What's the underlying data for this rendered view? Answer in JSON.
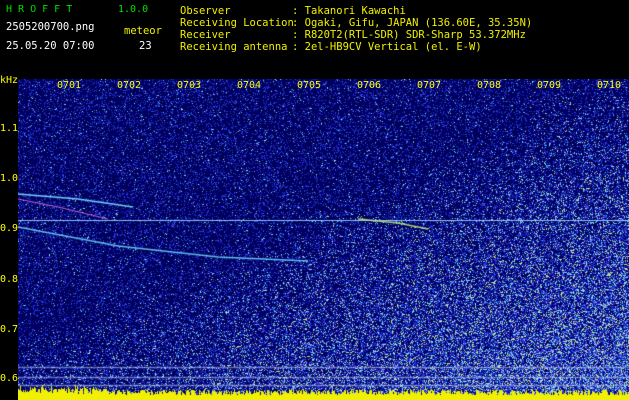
{
  "header": {
    "app_name": "H R O F F T",
    "version": "1.0.0",
    "filename": "2505200700.png",
    "datetime": "25.05.20 07:00",
    "count_label": "meteor",
    "count_value": "23",
    "info_labels": [
      "Observer",
      "Receiving Location",
      "Receiver",
      "Receiving antenna"
    ],
    "info_values": [
      ": Takanori Kawachi",
      ": Ogaki, Gifu, JAPAN (136.60E, 35.35N)",
      ": R820T2(RTL-SDR) SDR-Sharp 53.372MHz",
      ": 2el-HB9CV Vertical (el. E-W)"
    ]
  },
  "axis": {
    "unit": "kHz",
    "freq_ticks": [
      "1.1",
      "1.0",
      "0.9",
      "0.8",
      "0.7",
      "0.6"
    ],
    "time_ticks": [
      "0701",
      "0702",
      "0703",
      "0704",
      "0705",
      "0706",
      "0707",
      "0708",
      "0709",
      "0710"
    ]
  },
  "colors": {
    "background": "#000000",
    "spectrogram_base": "#000064",
    "info_text": "#f0f000",
    "title_text": "#00e000",
    "tick_text": "#ffff00",
    "signal": "#5fe0ff"
  }
}
